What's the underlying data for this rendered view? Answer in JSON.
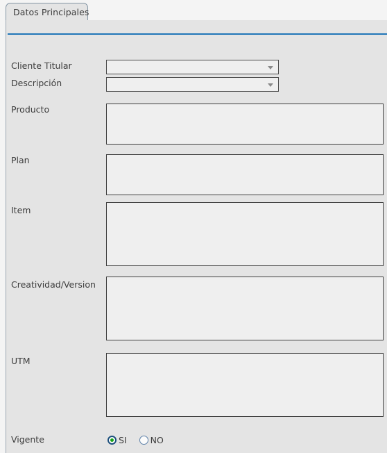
{
  "window": {
    "background_color": "#e4e4e4",
    "accent_color": "#2176b8"
  },
  "tabs": [
    {
      "label": "Datos Principales",
      "active": true
    }
  ],
  "form": {
    "fields": [
      {
        "label": "Cliente Titular",
        "type": "combobox",
        "value": "",
        "placeholder": ""
      },
      {
        "label": "Descripción",
        "type": "combobox",
        "value": "",
        "placeholder": ""
      },
      {
        "label": "Producto",
        "type": "textarea",
        "value": "",
        "placeholder": ""
      },
      {
        "label": "Plan",
        "type": "textarea",
        "value": "",
        "placeholder": ""
      },
      {
        "label": "Item",
        "type": "textarea",
        "value": "",
        "placeholder": ""
      },
      {
        "label": "Creatividad/Version",
        "type": "textarea",
        "value": "",
        "placeholder": ""
      },
      {
        "label": "UTM",
        "type": "textarea",
        "value": "",
        "placeholder": ""
      }
    ],
    "vigente": {
      "label": "Vigente",
      "options": [
        {
          "label": "SI",
          "selected": true
        },
        {
          "label": "NO",
          "selected": false
        }
      ]
    }
  },
  "icons": {
    "combo_arrow": "chevron-down-icon",
    "radio_selected": "radio-checked-icon",
    "radio_unselected": "radio-unchecked-icon"
  }
}
